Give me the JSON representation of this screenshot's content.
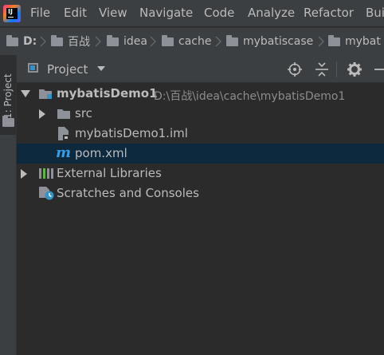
{
  "menubar": {
    "items": [
      "File",
      "Edit",
      "View",
      "Navigate",
      "Code",
      "Analyze",
      "Refactor",
      "Bui"
    ]
  },
  "navbar": {
    "crumbs": [
      "D:",
      "百战",
      "idea",
      "cache",
      "mybatiscase",
      "mybat"
    ]
  },
  "sidebar": {
    "tab_label": "1: Project"
  },
  "toolwindow": {
    "title": "Project"
  },
  "tree": {
    "root": {
      "label": "mybatisDemo1",
      "path": "D:\\百战\\idea\\cache\\mybatisDemo1"
    },
    "src": "src",
    "iml": "mybatisDemo1.iml",
    "pom": "pom.xml",
    "libraries": "External Libraries",
    "scratches": "Scratches and Consoles"
  },
  "colors": {
    "background": "#2b2b2b",
    "chrome": "#3c3f41",
    "selection": "#0d293e",
    "folder_icon": "#8e9298",
    "maven_icon": "#3b9ae0"
  }
}
